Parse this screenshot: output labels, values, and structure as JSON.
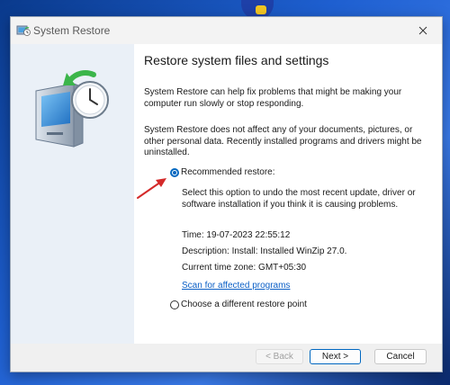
{
  "window": {
    "title": "System Restore"
  },
  "main": {
    "heading": "Restore system files and settings",
    "para1": "System Restore can help fix problems that might be making your computer run slowly or stop responding.",
    "para2": "System Restore does not affect any of your documents, pictures, or other personal data. Recently installed programs and drivers might be uninstalled.",
    "options": {
      "recommended": {
        "label": "Recommended restore:",
        "selected": true,
        "description": "Select this option to undo the most recent update, driver or software installation if you think it is causing problems.",
        "time": "Time: 19-07-2023 22:55:12",
        "description_line": "Description: Install: Installed WinZip 27.0.",
        "timezone": "Current time zone: GMT+05:30",
        "scan_link": "Scan for affected programs"
      },
      "different": {
        "label": "Choose a different restore point",
        "selected": false
      }
    }
  },
  "footer": {
    "back_label": "< Back",
    "next_label": "Next >",
    "cancel_label": "Cancel"
  },
  "colors": {
    "accent": "#0067c0",
    "link": "#0b5fc6",
    "annotation_arrow": "#d42a2a"
  },
  "icons": {
    "title": "system-restore-icon",
    "illustration": "restore-computer-clock-icon",
    "close": "close-icon"
  }
}
